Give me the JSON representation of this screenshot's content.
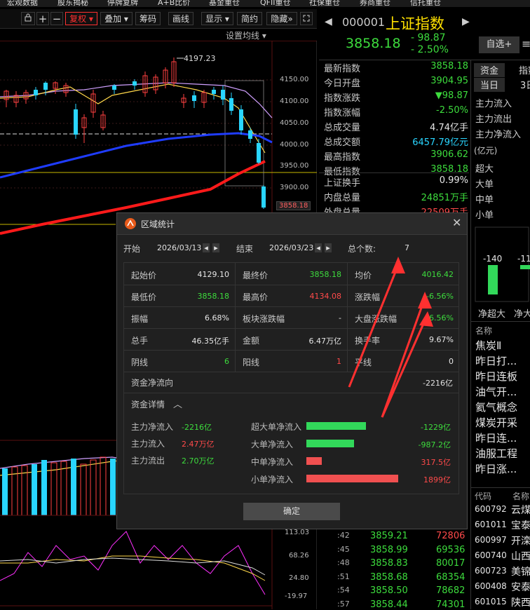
{
  "top_menu": [
    "宏观数据",
    "股东揭秘",
    "停牌复牌",
    "A+B比价",
    "基金重仓",
    "QFII重仓",
    "社保重仓",
    "券商重仓",
    "信托重仓"
  ],
  "toolbar": {
    "fuquan": "复权",
    "diejia": "叠加",
    "chouma": "筹码",
    "huaxian": "画线",
    "xianshi": "显示",
    "jianyue": "简约",
    "yincang": "隐藏",
    "set_ma": "设置均线"
  },
  "chart": {
    "high_label": "4197.23",
    "price_axis": [
      "4150.00",
      "4100.00",
      "4050.00",
      "4000.00",
      "3950.00",
      "3900.00"
    ],
    "current_price_tag": "3858.18",
    "osc_axis": [
      "113.03",
      "68.26",
      "24.80",
      "-19.97"
    ]
  },
  "index_header": {
    "code": "000001",
    "name": "上证指数",
    "price": "3858.18",
    "change": "- 98.87",
    "pct": "- 2.50%",
    "watch_btn": "自选+",
    "menu_icon": "≡"
  },
  "quote_rows": [
    {
      "k": "最新指数",
      "v": "3858.18",
      "c": "green"
    },
    {
      "k": "今日开盘",
      "v": "3904.95",
      "c": "green"
    },
    {
      "k": "指数涨跌",
      "v": "▼98.87",
      "c": "green"
    },
    {
      "k": "指数涨幅",
      "v": "-2.50%",
      "c": "green"
    },
    {
      "k": "总成交量",
      "v": "4.74亿手",
      "c": "white"
    },
    {
      "k": "总成交额",
      "v": "6457.79亿元",
      "c": "cyan"
    },
    {
      "k": "最高指数",
      "v": "3906.62",
      "c": "green"
    },
    {
      "k": "最低指数",
      "v": "3858.18",
      "c": "green"
    },
    {
      "k": "上证换手",
      "v": "0.99%",
      "c": "white"
    },
    {
      "k": "内盘总量",
      "v": "24851万手",
      "c": "green"
    },
    {
      "k": "外盘总量",
      "v": "22509万手",
      "c": "red"
    }
  ],
  "side_tabs": {
    "t1": "资金",
    "t2": "指数",
    "d1": "当日",
    "d2": "3日",
    "flows": [
      "主力流入",
      "主力流出",
      "主力净流入"
    ],
    "unit": "(亿元)",
    "cats": [
      "超大",
      "大单",
      "中单",
      "小单"
    ],
    "bar_vals": [
      "-140",
      "-11"
    ],
    "bar_names": [
      "净超大",
      "净大"
    ],
    "name_header": "名称",
    "sectors": [
      "焦炭Ⅱ",
      "昨日打...",
      "昨日连板",
      "油气开...",
      "氦气概念",
      "煤炭开采",
      "昨日连...",
      "油服工程",
      "昨日涨..."
    ],
    "code_header": "代码",
    "name_header2": "名称",
    "stocks": [
      {
        "code": "600792",
        "name": "云煤"
      },
      {
        "code": "601011",
        "name": "宝泰"
      },
      {
        "code": "600997",
        "name": "开滦"
      },
      {
        "code": "600740",
        "name": "山西"
      },
      {
        "code": "600723",
        "name": "美锦"
      },
      {
        "code": "600408",
        "name": "安泰"
      },
      {
        "code": "601015",
        "name": "陕西"
      }
    ]
  },
  "ticks": [
    {
      "t": ":42",
      "p": "3859.21",
      "v": "72806",
      "vc": "red"
    },
    {
      "t": ":45",
      "p": "3858.99",
      "v": "69536",
      "vc": "green"
    },
    {
      "t": ":48",
      "p": "3858.83",
      "v": "80017",
      "vc": "green"
    },
    {
      "t": ":51",
      "p": "3858.68",
      "v": "68354",
      "vc": "green"
    },
    {
      "t": ":54",
      "p": "3858.50",
      "v": "78682",
      "vc": "green"
    },
    {
      "t": ":57",
      "p": "3858.44",
      "v": "74301",
      "vc": "green"
    }
  ],
  "dialog": {
    "title": "区域统计",
    "start_label": "开始",
    "start_date": "2026/03/13",
    "end_label": "结束",
    "end_date": "2026/03/23",
    "count_label": "总个数:",
    "count": "7",
    "grid": [
      [
        {
          "k": "起始价",
          "v": "4129.10",
          "c": "white"
        },
        {
          "k": "最终价",
          "v": "3858.18",
          "c": "green"
        },
        {
          "k": "均价",
          "v": "4016.42",
          "c": "green"
        }
      ],
      [
        {
          "k": "最低价",
          "v": "3858.18",
          "c": "green"
        },
        {
          "k": "最高价",
          "v": "4134.08",
          "c": "red"
        },
        {
          "k": "涨跌幅",
          "v": "-6.56%",
          "c": "green"
        }
      ],
      [
        {
          "k": "振幅",
          "v": "6.68%",
          "c": "white"
        },
        {
          "k": "板块涨跌幅",
          "v": "-",
          "c": "white"
        },
        {
          "k": "大盘涨跌幅",
          "v": "-6.56%",
          "c": "green"
        }
      ],
      [
        {
          "k": "总手",
          "v": "46.35亿手",
          "c": "white"
        },
        {
          "k": "金额",
          "v": "6.47万亿",
          "c": "white"
        },
        {
          "k": "换手率",
          "v": "9.67%",
          "c": "white"
        }
      ],
      [
        {
          "k": "阴线",
          "v": "6",
          "c": "green"
        },
        {
          "k": "阳线",
          "v": "1",
          "c": "red"
        },
        {
          "k": "平线",
          "v": "0",
          "c": "white"
        }
      ]
    ],
    "net_flow_label": "资金净流向",
    "net_flow_value": "-2216亿",
    "detail_label": "资金详情",
    "left_flows": [
      {
        "k": "主力净流入",
        "v": "-2216亿",
        "c": "green"
      },
      {
        "k": "主力流入",
        "v": "2.47万亿",
        "c": "red"
      },
      {
        "k": "主力流出",
        "v": "2.70万亿",
        "c": "green"
      }
    ],
    "right_flows": [
      {
        "k": "超大单净流入",
        "v": "-1229亿",
        "c": "green",
        "frac": 0.65,
        "bc": "#32d85a"
      },
      {
        "k": "大单净流入",
        "v": "-987.2亿",
        "c": "green",
        "frac": 0.52,
        "bc": "#32d85a"
      },
      {
        "k": "中单净流入",
        "v": "317.5亿",
        "c": "red",
        "frac": 0.17,
        "bc": "#f05050"
      },
      {
        "k": "小单净流入",
        "v": "1899亿",
        "c": "red",
        "frac": 1.0,
        "bc": "#f05050"
      }
    ],
    "ok": "确定"
  }
}
